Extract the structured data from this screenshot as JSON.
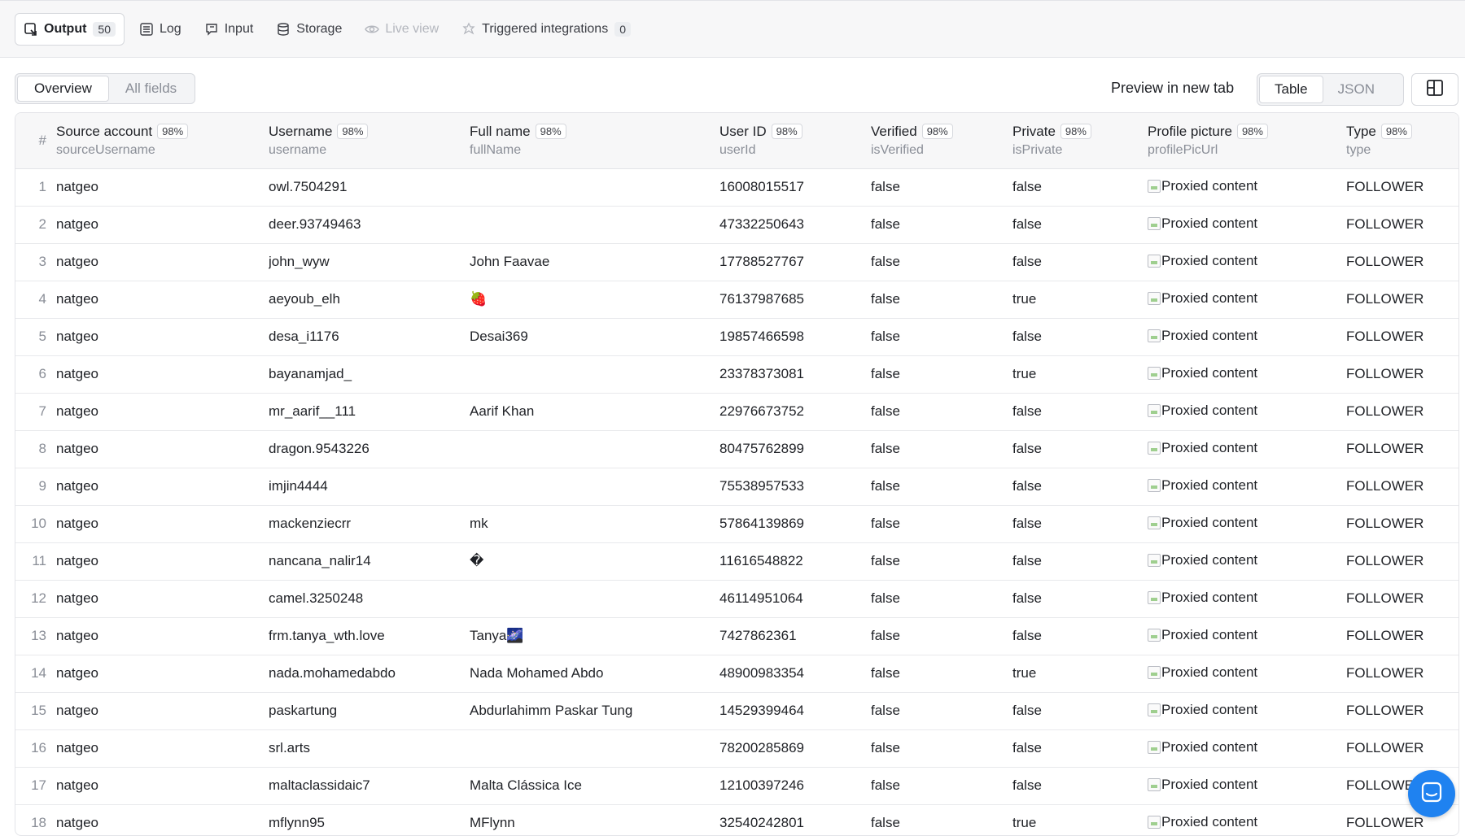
{
  "tabs": [
    {
      "label": "Output",
      "count": "50"
    },
    {
      "label": "Log"
    },
    {
      "label": "Input"
    },
    {
      "label": "Storage"
    },
    {
      "label": "Live view"
    },
    {
      "label": "Triggered integrations",
      "count": "0"
    }
  ],
  "view_toggle": {
    "overview": "Overview",
    "all_fields": "All fields"
  },
  "preview_label": "Preview in new tab",
  "format_toggle": {
    "table": "Table",
    "json": "JSON"
  },
  "columns": [
    {
      "name": "#"
    },
    {
      "name": "Source account",
      "pct": "98%",
      "key": "sourceUsername"
    },
    {
      "name": "Username",
      "pct": "98%",
      "key": "username"
    },
    {
      "name": "Full name",
      "pct": "98%",
      "key": "fullName"
    },
    {
      "name": "User ID",
      "pct": "98%",
      "key": "userId"
    },
    {
      "name": "Verified",
      "pct": "98%",
      "key": "isVerified"
    },
    {
      "name": "Private",
      "pct": "98%",
      "key": "isPrivate"
    },
    {
      "name": "Profile picture",
      "pct": "98%",
      "key": "profilePicUrl"
    },
    {
      "name": "Type",
      "pct": "98%",
      "key": "type"
    }
  ],
  "rows": [
    {
      "n": "1",
      "source": "natgeo",
      "username": "owl.7504291",
      "fullname": "",
      "userid": "16008015517",
      "verified": "false",
      "private": "false",
      "pic": "Proxied content",
      "type": "FOLLOWER"
    },
    {
      "n": "2",
      "source": "natgeo",
      "username": "deer.93749463",
      "fullname": "",
      "userid": "47332250643",
      "verified": "false",
      "private": "false",
      "pic": "Proxied content",
      "type": "FOLLOWER"
    },
    {
      "n": "3",
      "source": "natgeo",
      "username": "john_wyw",
      "fullname": "John Faavae",
      "userid": "17788527767",
      "verified": "false",
      "private": "false",
      "pic": "Proxied content",
      "type": "FOLLOWER"
    },
    {
      "n": "4",
      "source": "natgeo",
      "username": "aeyoub_elh",
      "fullname": "🍓",
      "userid": "76137987685",
      "verified": "false",
      "private": "true",
      "pic": "Proxied content",
      "type": "FOLLOWER"
    },
    {
      "n": "5",
      "source": "natgeo",
      "username": "desa_i1176",
      "fullname": "Desai369",
      "userid": "19857466598",
      "verified": "false",
      "private": "false",
      "pic": "Proxied content",
      "type": "FOLLOWER"
    },
    {
      "n": "6",
      "source": "natgeo",
      "username": "bayanamjad_",
      "fullname": "",
      "userid": "23378373081",
      "verified": "false",
      "private": "true",
      "pic": "Proxied content",
      "type": "FOLLOWER"
    },
    {
      "n": "7",
      "source": "natgeo",
      "username": "mr_aarif__111",
      "fullname": "Aarif Khan",
      "userid": "22976673752",
      "verified": "false",
      "private": "false",
      "pic": "Proxied content",
      "type": "FOLLOWER"
    },
    {
      "n": "8",
      "source": "natgeo",
      "username": "dragon.9543226",
      "fullname": "",
      "userid": "80475762899",
      "verified": "false",
      "private": "false",
      "pic": "Proxied content",
      "type": "FOLLOWER"
    },
    {
      "n": "9",
      "source": "natgeo",
      "username": "imjin4444",
      "fullname": "",
      "userid": "75538957533",
      "verified": "false",
      "private": "false",
      "pic": "Proxied content",
      "type": "FOLLOWER"
    },
    {
      "n": "10",
      "source": "natgeo",
      "username": "mackenziecrr",
      "fullname": "mk",
      "userid": "57864139869",
      "verified": "false",
      "private": "false",
      "pic": "Proxied content",
      "type": "FOLLOWER"
    },
    {
      "n": "11",
      "source": "natgeo",
      "username": "nancana_nalir14",
      "fullname": "�",
      "userid": "11616548822",
      "verified": "false",
      "private": "false",
      "pic": "Proxied content",
      "type": "FOLLOWER"
    },
    {
      "n": "12",
      "source": "natgeo",
      "username": "camel.3250248",
      "fullname": "",
      "userid": "46114951064",
      "verified": "false",
      "private": "false",
      "pic": "Proxied content",
      "type": "FOLLOWER"
    },
    {
      "n": "13",
      "source": "natgeo",
      "username": "frm.tanya_wth.love",
      "fullname": "Tanya🌌",
      "userid": "7427862361",
      "verified": "false",
      "private": "false",
      "pic": "Proxied content",
      "type": "FOLLOWER"
    },
    {
      "n": "14",
      "source": "natgeo",
      "username": "nada.mohamedabdo",
      "fullname": "Nada Mohamed Abdo",
      "userid": "48900983354",
      "verified": "false",
      "private": "true",
      "pic": "Proxied content",
      "type": "FOLLOWER"
    },
    {
      "n": "15",
      "source": "natgeo",
      "username": "paskartung",
      "fullname": "Abdurlahimm Paskar Tung",
      "userid": "14529399464",
      "verified": "false",
      "private": "false",
      "pic": "Proxied content",
      "type": "FOLLOWER"
    },
    {
      "n": "16",
      "source": "natgeo",
      "username": "srl.arts",
      "fullname": "",
      "userid": "78200285869",
      "verified": "false",
      "private": "false",
      "pic": "Proxied content",
      "type": "FOLLOWER"
    },
    {
      "n": "17",
      "source": "natgeo",
      "username": "maltaclassidaic7",
      "fullname": "Malta Clássica Ice",
      "userid": "12100397246",
      "verified": "false",
      "private": "false",
      "pic": "Proxied content",
      "type": "FOLLOWER"
    },
    {
      "n": "18",
      "source": "natgeo",
      "username": "mflynn95",
      "fullname": "MFlynn",
      "userid": "32540242801",
      "verified": "false",
      "private": "true",
      "pic": "Proxied content",
      "type": "FOLLOWER"
    }
  ]
}
